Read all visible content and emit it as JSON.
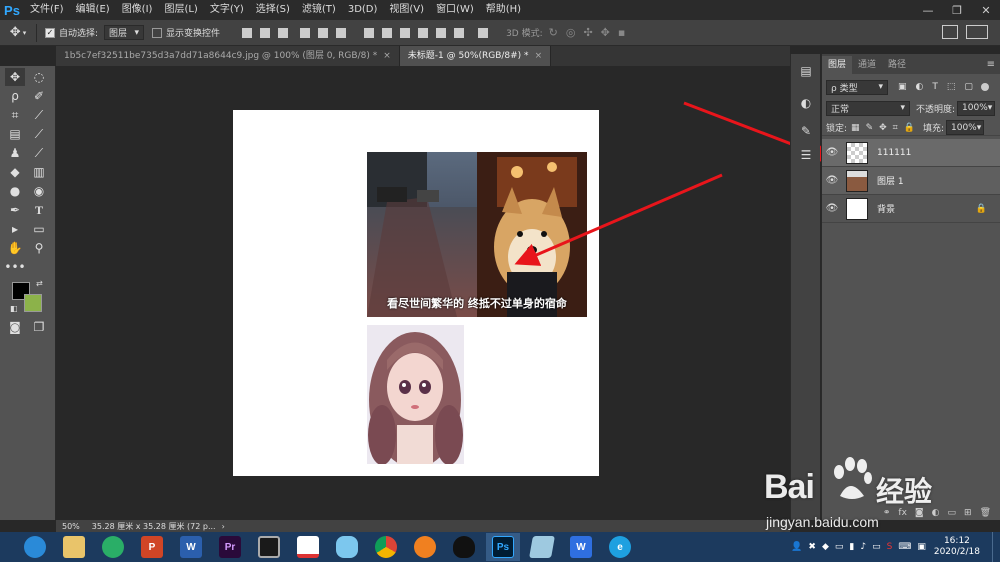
{
  "app": {
    "logo": "Ps"
  },
  "menu": [
    "文件(F)",
    "编辑(E)",
    "图像(I)",
    "图层(L)",
    "文字(Y)",
    "选择(S)",
    "滤镜(T)",
    "3D(D)",
    "视图(V)",
    "窗口(W)",
    "帮助(H)"
  ],
  "window_controls": {
    "minimize": "—",
    "restore": "❐",
    "close": "✕"
  },
  "options": {
    "auto_select_label": "自动选择:",
    "auto_select_value": "图层",
    "show_transform_label": "显示变换控件",
    "mode_3d_label": "3D 模式:"
  },
  "tabs": [
    {
      "label": "1b5c7ef32511be735d3a7dd71a8644c9.jpg @ 100% (图层 0, RGB/8) *",
      "close": "×"
    },
    {
      "label": "未标题-1 @ 50%(RGB/8#) *",
      "close": "×"
    }
  ],
  "canvas": {
    "dog_caption": "看尽世间繁华的 终抵不过单身的宿命"
  },
  "layers_panel": {
    "tabs": [
      "图层",
      "通道",
      "路径"
    ],
    "filter_label": "ρ 类型",
    "blend_mode": "正常",
    "opacity_label": "不透明度:",
    "opacity_value": "100%",
    "lock_label": "锁定:",
    "fill_label": "填充:",
    "fill_value": "100%",
    "layers": [
      {
        "name": "111111"
      },
      {
        "name": "图层 1"
      },
      {
        "name": "背景"
      }
    ]
  },
  "status": {
    "zoom": "50%",
    "doc_info": "35.28 厘米 x 35.28 厘米 (72 p..."
  },
  "taskbar": {
    "apps": [
      "browser",
      "files",
      "wechat",
      "powerpoint",
      "word",
      "premiere",
      "video",
      "wps-pdf",
      "qq-browser",
      "chrome",
      "firefox",
      "qq",
      "photoshop",
      "notes",
      "wps",
      "ie"
    ],
    "app_glyphs": {
      "powerpoint": "P",
      "word": "W",
      "premiere": "Pr",
      "photoshop": "Ps",
      "wps": "W"
    },
    "clock_time": "16:12",
    "clock_date": "2020/2/18"
  },
  "watermark": {
    "brand": "Bai",
    "brand2": "经验",
    "url": "jingyan.baidu.com"
  },
  "colors": {
    "accent": "#31a8ff",
    "arrow": "#e8151b",
    "foreground_swatch": "#000000",
    "background_swatch": "#8cb24a"
  }
}
